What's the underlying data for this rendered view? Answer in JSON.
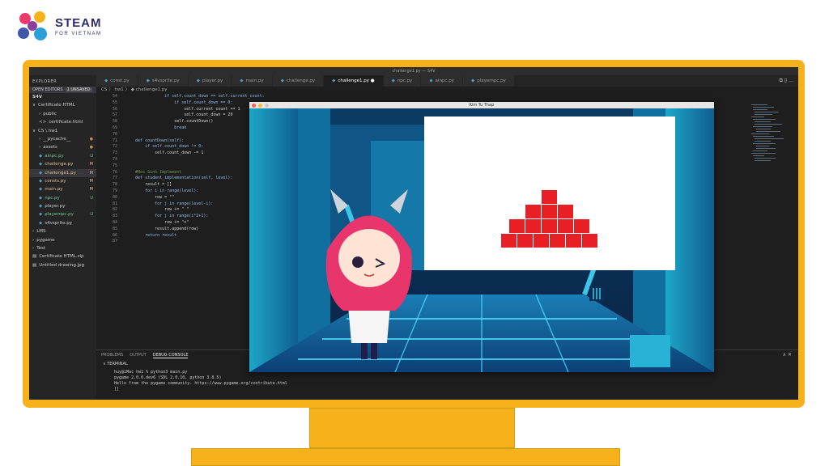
{
  "brand": {
    "title": "STEAM",
    "subtitle": "FOR VIETNAM"
  },
  "vscode": {
    "window_title": "challenge1.py — S4V",
    "sidebar": {
      "header": "EXPLORER",
      "open_editors": "OPEN EDITORS",
      "unsaved_badge": "1 UNSAVED",
      "root": "S4V",
      "items": [
        {
          "label": "Certificate HTML",
          "prefix": "∨",
          "status": ""
        },
        {
          "label": "public",
          "prefix": "›",
          "status": ""
        },
        {
          "label": "certificate.html",
          "prefix": "<>",
          "status": ""
        },
        {
          "label": "CS \\ hw1",
          "prefix": "∨",
          "status": ""
        },
        {
          "label": "__pycache__",
          "prefix": "›",
          "status": "●"
        },
        {
          "label": "assets",
          "prefix": "›",
          "status": "●"
        },
        {
          "label": "ainpc.py",
          "prefix": "◆",
          "status": "U"
        },
        {
          "label": "challenge.py",
          "prefix": "◆",
          "status": "M"
        },
        {
          "label": "challenge1.py",
          "prefix": "◆",
          "status": "M"
        },
        {
          "label": "consts.py",
          "prefix": "◆",
          "status": "M"
        },
        {
          "label": "main.py",
          "prefix": "◆",
          "status": "M"
        },
        {
          "label": "npc.py",
          "prefix": "◆",
          "status": "U"
        },
        {
          "label": "player.py",
          "prefix": "◆",
          "status": ""
        },
        {
          "label": "playernpc.py",
          "prefix": "◆",
          "status": "U"
        },
        {
          "label": "s4vsprite.py",
          "prefix": "◆",
          "status": ""
        },
        {
          "label": "LMS",
          "prefix": "›",
          "status": ""
        },
        {
          "label": "pygame",
          "prefix": "›",
          "status": ""
        },
        {
          "label": "Test",
          "prefix": "›",
          "status": ""
        },
        {
          "label": "Certificate HTML.zip",
          "prefix": "▤",
          "status": ""
        },
        {
          "label": "Untitled drawing.jpg",
          "prefix": "▤",
          "status": ""
        }
      ]
    },
    "tabs": [
      {
        "label": "const.py",
        "active": false
      },
      {
        "label": "s4vsprite.py",
        "active": false
      },
      {
        "label": "player.py",
        "active": false
      },
      {
        "label": "main.py",
        "active": false
      },
      {
        "label": "challenge.py",
        "active": false
      },
      {
        "label": "challenge1.py ●",
        "active": true
      },
      {
        "label": "npc.py",
        "active": false
      },
      {
        "label": "ainpc.py",
        "active": false
      },
      {
        "label": "playernpc.py",
        "active": false
      }
    ],
    "tab_actions": "⧉  ▯  …",
    "breadcrumb": "CS 〉 hw1 〉 ◆ challenge1.py",
    "code_lines": [
      {
        "ln": "54",
        "text": "                if self.count_down == self.current_count:"
      },
      {
        "ln": "55",
        "text": "                    if self.count_down == 0:"
      },
      {
        "ln": "56",
        "text": "                        self.current_count += 1"
      },
      {
        "ln": "57",
        "text": "                        self.count_down = 20"
      },
      {
        "ln": "58",
        "text": "                    self.countDown()"
      },
      {
        "ln": "69",
        "text": "                    break"
      },
      {
        "ln": "70",
        "text": ""
      },
      {
        "ln": "71",
        "text": "    def countDown(self):"
      },
      {
        "ln": "72",
        "text": "        if self.count_down != 0:"
      },
      {
        "ln": "73",
        "text": "            self.count_down -= 1"
      },
      {
        "ln": "74",
        "text": ""
      },
      {
        "ln": "75",
        "text": ""
      },
      {
        "ln": "76",
        "text": "    #Hoc Sinh Implement"
      },
      {
        "ln": "77",
        "text": "    def student_implementation(self, level):"
      },
      {
        "ln": "78",
        "text": "        result = []"
      },
      {
        "ln": "79",
        "text": "        for i in range(level):"
      },
      {
        "ln": "80",
        "text": "            row = \"\""
      },
      {
        "ln": "81",
        "text": "            for j in range(level-i):"
      },
      {
        "ln": "82",
        "text": "                row += \" \""
      },
      {
        "ln": "83",
        "text": "            for j in range(i*2+1):"
      },
      {
        "ln": "84",
        "text": "                row += \"x\""
      },
      {
        "ln": "85",
        "text": "            result.append(row)"
      },
      {
        "ln": "86",
        "text": "        return result"
      },
      {
        "ln": "87",
        "text": ""
      }
    ],
    "panel": {
      "tabs": [
        "PROBLEMS",
        "OUTPUT",
        "DEBUG CONSOLE"
      ],
      "active_tab": "DEBUG CONSOLE",
      "controls": "∧  ✕",
      "terminal_label": "∨ TERMINAL",
      "lines": [
        "huy@iMac hw1 % python3 main.py",
        "pygame 2.0.0.dev6 (SDL 2.0.10, python 3.8.5)",
        "Hello from the pygame community. https://www.pygame.org/contribute.html",
        "[]"
      ]
    }
  },
  "pygame_window": {
    "title": "Kim Tu Thap",
    "pyramid_rows": [
      1,
      3,
      5,
      6
    ],
    "brick_color": "#e81f25"
  }
}
